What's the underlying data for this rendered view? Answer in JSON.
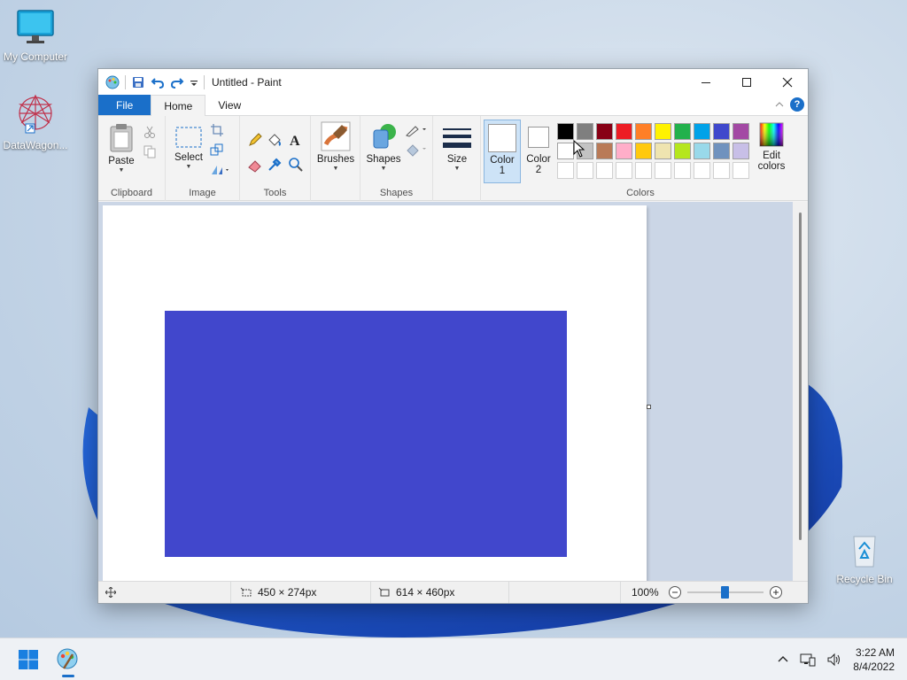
{
  "desktop": {
    "icons": [
      {
        "label": "My Computer"
      },
      {
        "label": "DataWagon..."
      },
      {
        "label": "Recycle Bin"
      }
    ]
  },
  "window": {
    "title": "Untitled - Paint",
    "tabs": [
      {
        "label": "File"
      },
      {
        "label": "Home"
      },
      {
        "label": "View"
      }
    ],
    "help_label": "?",
    "ribbon": {
      "clipboard": {
        "paste_label": "Paste",
        "group_label": "Clipboard"
      },
      "image": {
        "select_label": "Select",
        "group_label": "Image"
      },
      "tools": {
        "group_label": "Tools"
      },
      "brushes": {
        "label": "Brushes"
      },
      "shapes": {
        "label": "Shapes",
        "group_label": "Shapes"
      },
      "size": {
        "label": "Size"
      },
      "colors": {
        "color1_label_line1": "Color",
        "color1_label_line2": "1",
        "color2_label_line1": "Color",
        "color2_label_line2": "2",
        "edit_label_line1": "Edit",
        "edit_label_line2": "colors",
        "group_label": "Colors",
        "color1_value": "#ffffff",
        "color2_value": "#ffffff",
        "row1": [
          "#000000",
          "#7f7f7f",
          "#880015",
          "#ed1c24",
          "#ff7f27",
          "#fff200",
          "#22b14c",
          "#00a2e8",
          "#3f48cc",
          "#a349a4"
        ],
        "row2": [
          "#ffffff",
          "#c3c3c3",
          "#b97a57",
          "#ffaec9",
          "#ffc90e",
          "#efe4b0",
          "#b5e61d",
          "#99d9ea",
          "#7092be",
          "#c8bfe7"
        ]
      }
    },
    "canvas": {
      "shape_color": "#4147cc"
    },
    "status": {
      "selection_size": "450 × 274px",
      "canvas_size": "614 × 460px",
      "zoom": "100%",
      "zoom_level": 0.5
    }
  },
  "taskbar": {
    "time": "3:22 AM",
    "date": "8/4/2022"
  }
}
